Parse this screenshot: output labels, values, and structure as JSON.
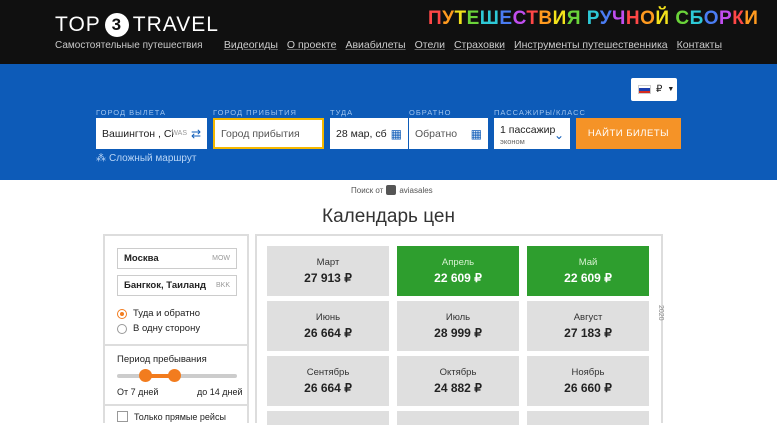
{
  "header": {
    "logo_left": "TOP",
    "logo_num": "3",
    "logo_right": "TRAVEL",
    "tagline": "Самостоятельные путешествия",
    "slogan_letters": [
      {
        "ch": "П",
        "color": "#ff4747"
      },
      {
        "ch": "У",
        "color": "#ff9a1f"
      },
      {
        "ch": "Т",
        "color": "#f3e21b"
      },
      {
        "ch": "Е",
        "color": "#6bd43a"
      },
      {
        "ch": "Ш",
        "color": "#2ec9d6"
      },
      {
        "ch": "Е",
        "color": "#4a7cf2"
      },
      {
        "ch": "С",
        "color": "#c04ef0"
      },
      {
        "ch": "Т",
        "color": "#ff4747"
      },
      {
        "ch": "В",
        "color": "#ff9a1f"
      },
      {
        "ch": "И",
        "color": "#f3e21b"
      },
      {
        "ch": "Я",
        "color": "#6bd43a"
      },
      {
        "ch": " ",
        "color": "#fff"
      },
      {
        "ch": "Р",
        "color": "#2ec9d6"
      },
      {
        "ch": "У",
        "color": "#4a7cf2"
      },
      {
        "ch": "Ч",
        "color": "#c04ef0"
      },
      {
        "ch": "Н",
        "color": "#ff4747"
      },
      {
        "ch": "О",
        "color": "#ff9a1f"
      },
      {
        "ch": "Й",
        "color": "#f3e21b"
      },
      {
        "ch": " ",
        "color": "#fff"
      },
      {
        "ch": "С",
        "color": "#6bd43a"
      },
      {
        "ch": "Б",
        "color": "#2ec9d6"
      },
      {
        "ch": "О",
        "color": "#4a7cf2"
      },
      {
        "ch": "Р",
        "color": "#c04ef0"
      },
      {
        "ch": "К",
        "color": "#ff4747"
      },
      {
        "ch": "И",
        "color": "#ff9a1f"
      }
    ],
    "nav": [
      "Видеогиды",
      "О проекте",
      "Авиабилеты",
      "Отели",
      "Страховки",
      "Инструменты путешественника",
      "Контакты"
    ]
  },
  "search": {
    "currency": "₽",
    "labels": {
      "from": "ГОРОД ВЫЛЕТА",
      "to": "ГОРОД ПРИБЫТИЯ",
      "depart": "ТУДА",
      "return": "ОБРАТНО",
      "passengers": "ПАССАЖИРЫ/КЛАСС"
    },
    "from_value": "Вашингтон , Сі",
    "from_code": "WAS",
    "to_placeholder": "Город прибытия",
    "depart_value": "28 мар, сб",
    "return_placeholder": "Обратно",
    "passengers": "1 пассажир",
    "class": "эконом",
    "submit": "НАЙТИ БИЛЕТЫ",
    "complex_route": "Сложный маршрут",
    "powered_by": "Поиск от",
    "powered_brand": "aviasales"
  },
  "calendar": {
    "title": "Календарь цен",
    "origin": "Москва",
    "origin_code": "MOW",
    "destination": "Бангкок, Таиланд",
    "destination_code": "BKK",
    "trip_round": "Туда и обратно",
    "trip_oneway": "В одну сторону",
    "stay_title": "Период пребывания",
    "stay_from": "От 7 дней",
    "stay_to": "до 14 дней",
    "direct_only": "Только прямые рейсы",
    "year": "2020",
    "months": [
      {
        "name": "Март",
        "price": "27 913 ₽",
        "best": false
      },
      {
        "name": "Апрель",
        "price": "22 609 ₽",
        "best": true
      },
      {
        "name": "Май",
        "price": "22 609 ₽",
        "best": true
      },
      {
        "name": "Июнь",
        "price": "26 664 ₽",
        "best": false
      },
      {
        "name": "Июль",
        "price": "28 999 ₽",
        "best": false
      },
      {
        "name": "Август",
        "price": "27 183 ₽",
        "best": false
      },
      {
        "name": "Сентябрь",
        "price": "26 664 ₽",
        "best": false
      },
      {
        "name": "Октябрь",
        "price": "24 882 ₽",
        "best": false
      },
      {
        "name": "Ноябрь",
        "price": "26 660 ₽",
        "best": false
      }
    ]
  }
}
